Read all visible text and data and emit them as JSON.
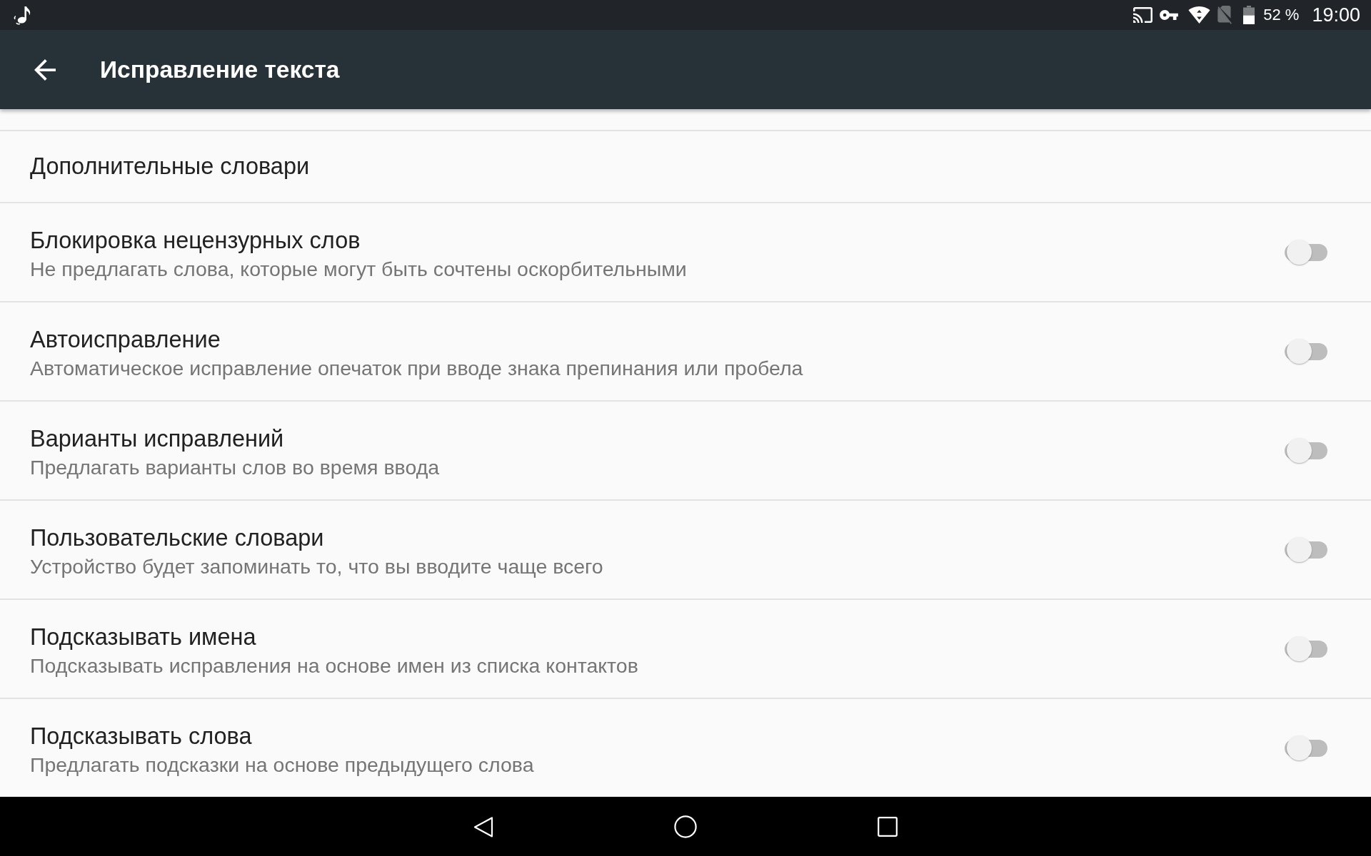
{
  "status_bar": {
    "battery_percent": "52 %",
    "time": "19:00"
  },
  "app_bar": {
    "title": "Исправление текста"
  },
  "settings": [
    {
      "kind": "link",
      "title": "Дополнительные словари"
    },
    {
      "kind": "switch",
      "title": "Блокировка нецензурных слов",
      "summary": "Не предлагать слова, которые могут быть сочтены оскорбительными",
      "on": false
    },
    {
      "kind": "switch",
      "title": "Автоисправление",
      "summary": "Автоматическое исправление опечаток при вводе знака препинания или пробела",
      "on": false
    },
    {
      "kind": "switch",
      "title": "Варианты исправлений",
      "summary": "Предлагать варианты слов во время ввода",
      "on": false
    },
    {
      "kind": "switch",
      "title": "Пользовательские словари",
      "summary": "Устройство будет запоминать то, что вы вводите чаще всего",
      "on": false
    },
    {
      "kind": "switch",
      "title": "Подсказывать имена",
      "summary": "Подсказывать исправления на основе имен из списка контактов",
      "on": false
    },
    {
      "kind": "switch",
      "title": "Подсказывать слова",
      "summary": "Предлагать подсказки на основе предыдущего слова",
      "on": false
    }
  ]
}
